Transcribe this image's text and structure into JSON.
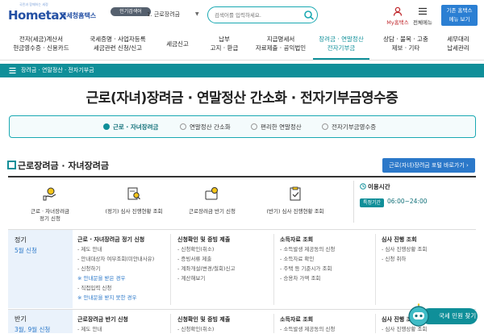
{
  "header": {
    "logo_text": "Hometax",
    "logo_suffix": "국세청홈택스",
    "logo_tagline": "국민과 함께하는 세정",
    "popular_badge": "인기검색어",
    "popular_rank": "1.  근로장려금",
    "search_placeholder": "검색어를 입력하세요.",
    "my_label": "My홈택스",
    "menu_label": "전체메뉴",
    "prev_line1": "기존 홈택스",
    "prev_line2": "메뉴 보기"
  },
  "gnb": [
    {
      "line1": "전자(세금)계산서",
      "line2": "현금영수증 · 신용카드"
    },
    {
      "line1": "국세증명 · 사업자등록",
      "line2": "세금관련 신청/신고"
    },
    {
      "line1": "세금신고",
      "line2": ""
    },
    {
      "line1": "납부",
      "line2": "고지 · 환급"
    },
    {
      "line1": "지급명세서",
      "line2": "자료제출 · 공익법인"
    },
    {
      "line1": "장려금 · 연말정산",
      "line2": "전자기부금"
    },
    {
      "line1": "상담 · 불복 · 고충",
      "line2": "제보 · 기타"
    },
    {
      "line1": "세무대리",
      "line2": "납세관리"
    }
  ],
  "breadcrumb": "장려금 · 연말정산 · 전자기부금",
  "page_title": "근로(자녀)장려금 · 연말정산 간소화 · 전자기부금영수증",
  "tabs": [
    {
      "label": "근로 · 자녀장려금",
      "active": true
    },
    {
      "label": "연말정산 간소화",
      "active": false
    },
    {
      "label": "편리한 연말정산",
      "active": false
    },
    {
      "label": "전자기부금영수증",
      "active": false
    }
  ],
  "section": {
    "title": "근로장려금 · 자녀장려금",
    "portal_button": "근로(자녀)장려금 포털 바로가기"
  },
  "quick_links": [
    {
      "icon": "hand-coin-icon",
      "line1": "근로 · 자녀장려금",
      "line2": "정기 신청"
    },
    {
      "icon": "document-search-icon",
      "line1": "(정기) 심사 진행현황 조회",
      "line2": ""
    },
    {
      "icon": "wallet-coin-icon",
      "line1": "근로장려금 반기 신청",
      "line2": ""
    },
    {
      "icon": "clipboard-check-icon",
      "line1": "(반기) 심사 진행현황 조회",
      "line2": ""
    }
  ],
  "hours": {
    "title": "이용시간",
    "badge": "특정기간",
    "time": "06:00~24:00"
  },
  "rows": [
    {
      "title": "정기",
      "subtitle": "5월 신청",
      "cols": [
        {
          "header": "근로 · 자녀장려금 정기 신청",
          "items": [
            {
              "t": "- 제도 안내",
              "note": false
            },
            {
              "t": "- 안내대상자 여부조회(미안내사유)",
              "note": false
            },
            {
              "t": "- 신청하기",
              "note": false
            },
            {
              "t": "※ 안내문을 받은 경우",
              "note": true
            },
            {
              "t": "- 직접입력 신청",
              "note": false
            },
            {
              "t": "※ 안내문을 받지 못한 경우",
              "note": true
            }
          ]
        },
        {
          "header": "신청확인 및 증빙 제출",
          "items": [
            {
              "t": "- 신청확인(취소)",
              "note": false
            },
            {
              "t": "- 증빙서류 제출",
              "note": false
            },
            {
              "t": "- 계좌개설(변경/철회)신고",
              "note": false
            },
            {
              "t": "- 계산해보기",
              "note": false
            }
          ]
        },
        {
          "header": "소득자료 조회",
          "items": [
            {
              "t": "- 소득발생 제공동의 신청",
              "note": false
            },
            {
              "t": "- 소득자료 확인",
              "note": false
            },
            {
              "t": "- 주택 등 기준시가 조회",
              "note": false
            },
            {
              "t": "- 승용차 가액 조회",
              "note": false
            }
          ]
        },
        {
          "header": "심사 진행 조회",
          "items": [
            {
              "t": "- 심사 진행상황 조회",
              "note": false
            },
            {
              "t": "- 신청 취하",
              "note": false
            }
          ]
        }
      ]
    },
    {
      "title": "반기",
      "subtitle": "3월, 9월 신청",
      "cols": [
        {
          "header": "근로장려금 반기 신청",
          "items": [
            {
              "t": "- 제도 안내",
              "note": false
            }
          ]
        },
        {
          "header": "신청확인 및 증빙 제출",
          "items": [
            {
              "t": "- 신청확인(취소)",
              "note": false
            }
          ]
        },
        {
          "header": "소득자료 조회",
          "items": [
            {
              "t": "- 소득발생 제공동의 신청",
              "note": false
            }
          ]
        },
        {
          "header": "심사 진행 조회",
          "items": [
            {
              "t": "- 심사 진행상황 조회",
              "note": false
            }
          ]
        }
      ]
    }
  ],
  "chatbot_label": "국세 민원 찾기",
  "colors": {
    "teal": "#0f8f99",
    "blue": "#2b78c9",
    "brand": "#2450a4",
    "my_red": "#c0282d"
  }
}
